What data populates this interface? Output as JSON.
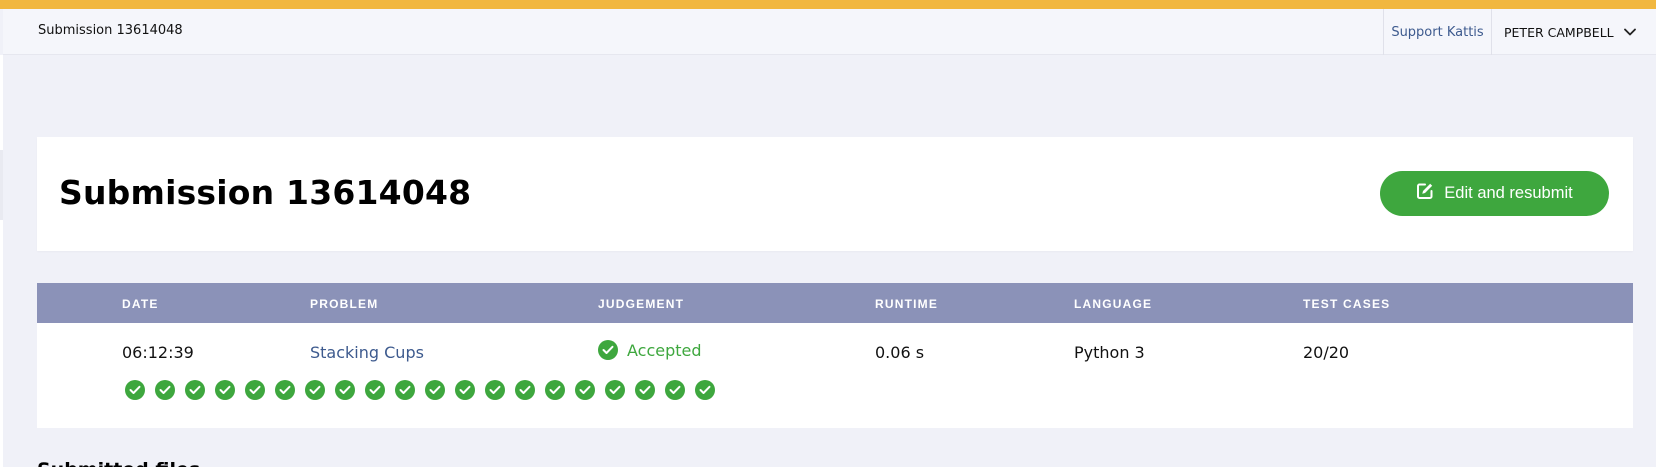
{
  "header": {
    "title": "Submission 13614048",
    "support_label": "Support Kattis",
    "user_name": "PETER CAMPBELL"
  },
  "title_card": {
    "heading": "Submission 13614048",
    "resubmit_label": "Edit and resubmit"
  },
  "results": {
    "columns": [
      "DATE",
      "PROBLEM",
      "JUDGEMENT",
      "RUNTIME",
      "LANGUAGE",
      "TEST CASES"
    ],
    "row": {
      "date": "06:12:39",
      "problem": "Stacking Cups",
      "judgement": "Accepted",
      "runtime": "0.06 s",
      "language": "Python 3",
      "test_cases": "20/20"
    },
    "test_case_count": 20,
    "test_cases_passed": 20
  },
  "next_section": {
    "heading": "Submitted files"
  },
  "colors": {
    "accent_bar": "#f1b73f",
    "success": "#3ea73e",
    "table_header": "#8b92b8",
    "link": "#3d5a8e"
  }
}
